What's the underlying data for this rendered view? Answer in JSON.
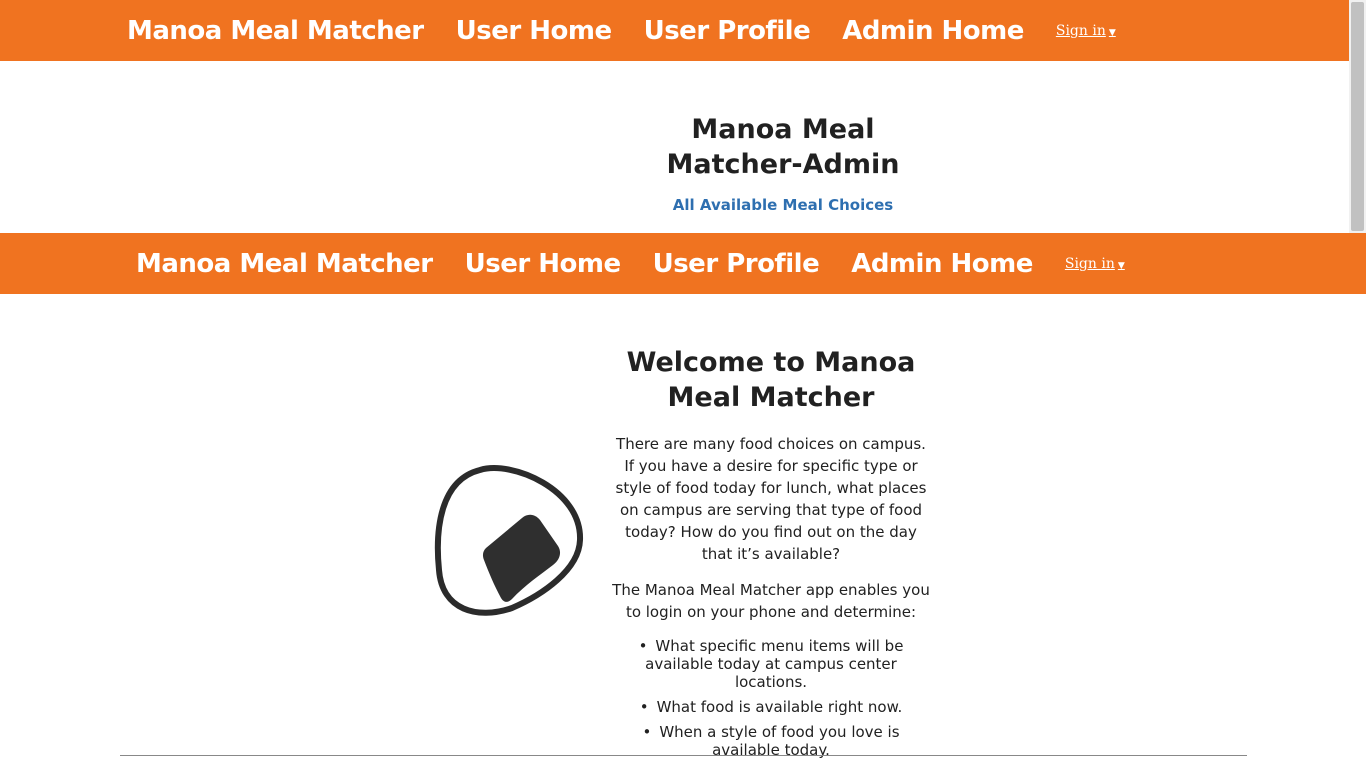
{
  "navbars": [
    {
      "brand": "Manoa Meal Matcher",
      "links": [
        "User Home",
        "User Profile",
        "Admin Home"
      ],
      "signin": "Sign in"
    },
    {
      "brand": "Manoa Meal Matcher",
      "links": [
        "User Home",
        "User Profile",
        "Admin Home"
      ],
      "signin": "Sign in"
    }
  ],
  "admin": {
    "title": "Manoa Meal Matcher-Admin",
    "link": "All Available Meal Choices"
  },
  "welcome": {
    "heading": "Welcome to Manoa Meal Matcher",
    "paragraph1": "There are many food choices on campus. If you have a desire for specific type or style of food today for lunch, what places on campus are serving that type of food today? How do you find out on the day that it’s available?",
    "paragraph2": "The Manoa Meal Matcher app enables you to login on your phone and determine:",
    "bullets": [
      "What specific menu items will be available today at campus center locations.",
      "What food is available right now.",
      "When a style of food you love is available today."
    ]
  },
  "logo_icon": "onigiri-icon",
  "colors": {
    "navbar": "#f07320",
    "link": "#2e6fb0",
    "text": "#212121"
  }
}
